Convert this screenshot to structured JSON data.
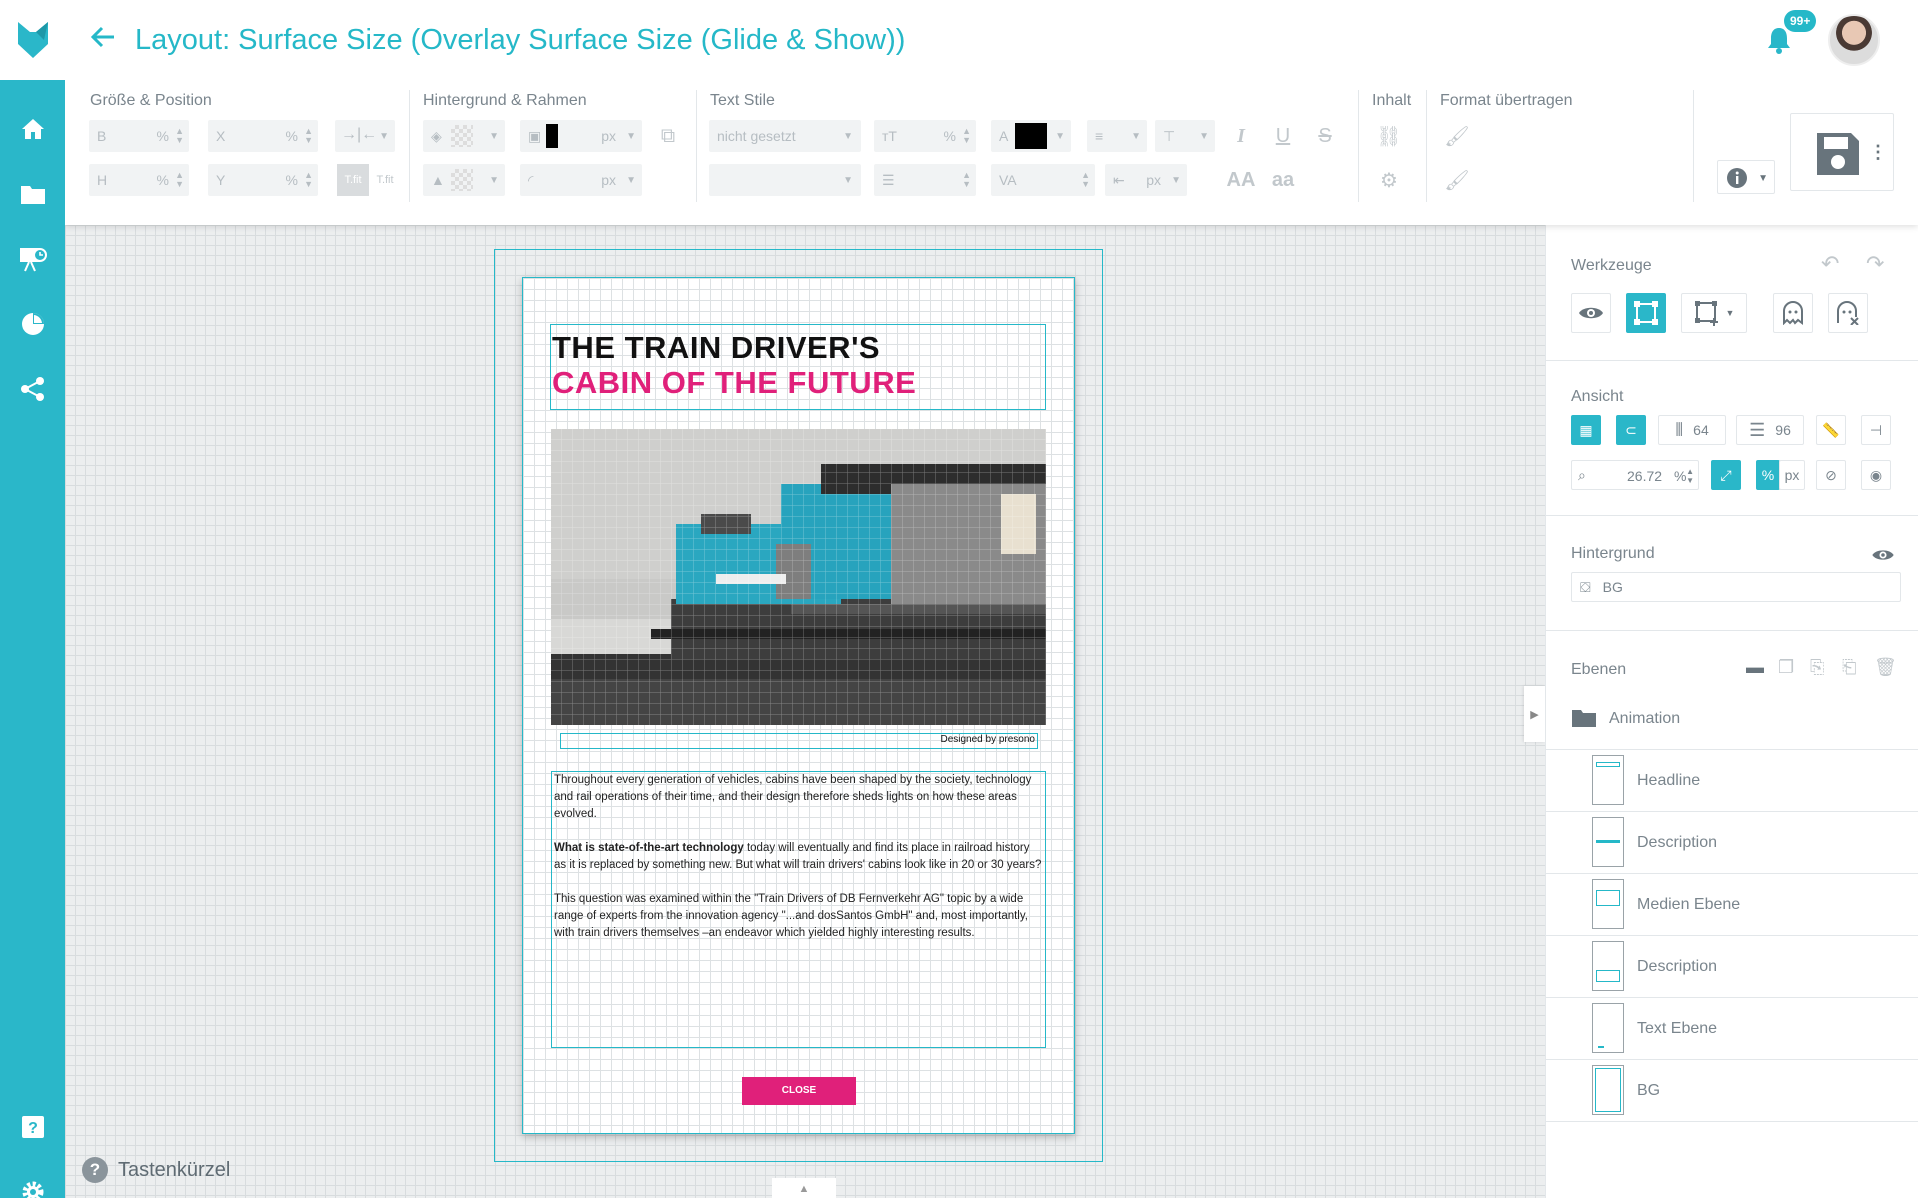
{
  "header": {
    "title": "Layout: Surface Size (Overlay Surface Size (Glide & Show))",
    "notification_badge": "99+"
  },
  "sidebar": {
    "items": [
      {
        "icon": "home-icon"
      },
      {
        "icon": "folder-icon"
      },
      {
        "icon": "presentation-clock-icon"
      },
      {
        "icon": "pie-chart-icon"
      },
      {
        "icon": "share-icon"
      }
    ],
    "bottom": [
      {
        "icon": "help-icon"
      },
      {
        "icon": "settings-icon"
      }
    ]
  },
  "toolbar": {
    "groups": {
      "size_position": "Größe & Position",
      "background_border": "Hintergrund & Rahmen",
      "text_style": "Text Stile",
      "content": "Inhalt",
      "format_transfer": "Format übertragen"
    },
    "fields": {
      "b": "B",
      "x": "X",
      "h": "H",
      "y": "Y",
      "percent": "%",
      "px": "px",
      "text_style_select": "nicht gesetzt"
    }
  },
  "canvas": {
    "headline_line1": "THE TRAIN DRIVER'S",
    "headline_line2": "CABIN OF THE FUTURE",
    "caption": "Designed by presono",
    "paragraph1": "Throughout every generation of vehicles, cabins have been shaped by the society, technology and rail operations of their time, and their design therefore sheds lights on how these areas evolved.",
    "paragraph2_bold": "What is state-of-the-art technology",
    "paragraph2_rest": " today will eventually and find its place in railroad history as it is replaced by something new. But what will train drivers' cabins look like in 20 or 30 years?",
    "paragraph3": "This question was examined within the \"Train Drivers of DB Fernverkehr AG\" topic by a wide range of experts from the innovation agency \"...and dosSantos GmbH\" and, most importantly, with train drivers themselves –an endeavor which yielded highly interesting results.",
    "close_label": "CLOSE",
    "shortcuts_label": "Tastenkürzel",
    "colors": {
      "accent": "#2ab7c9",
      "headline_pink": "#e0207a"
    }
  },
  "right_panel": {
    "tools_label": "Werkzeuge",
    "view_label": "Ansicht",
    "columns_value": "64",
    "rows_value": "96",
    "zoom_value": "26.72",
    "zoom_unit": "%",
    "unit_percent": "%",
    "unit_px": "px",
    "background_label": "Hintergrund",
    "background_value": "BG",
    "layers_label": "Ebenen",
    "layers": [
      {
        "name": "Animation",
        "type": "folder"
      },
      {
        "name": "Headline",
        "type": "layer"
      },
      {
        "name": "Description",
        "type": "layer"
      },
      {
        "name": "Medien Ebene",
        "type": "layer"
      },
      {
        "name": "Description",
        "type": "layer"
      },
      {
        "name": "Text Ebene",
        "type": "layer"
      },
      {
        "name": "BG",
        "type": "layer"
      }
    ]
  }
}
